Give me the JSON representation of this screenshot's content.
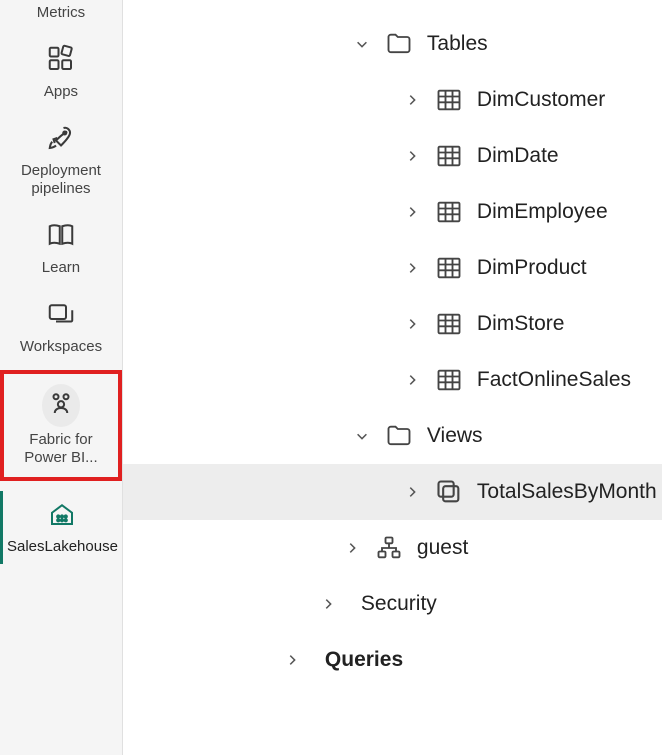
{
  "sidebar": {
    "items": [
      {
        "label": "Metrics"
      },
      {
        "label": "Apps"
      },
      {
        "label": "Deployment pipelines"
      },
      {
        "label": "Learn"
      },
      {
        "label": "Workspaces"
      },
      {
        "label": "Fabric for Power BI..."
      },
      {
        "label": "SalesLakehouse"
      }
    ]
  },
  "tree": {
    "tables": {
      "label": "Tables",
      "items": [
        "DimCustomer",
        "DimDate",
        "DimEmployee",
        "DimProduct",
        "DimStore",
        "FactOnlineSales"
      ]
    },
    "views": {
      "label": "Views",
      "items": [
        "TotalSalesByMonth"
      ]
    },
    "guest": {
      "label": "guest"
    },
    "security": {
      "label": "Security"
    },
    "queries": {
      "label": "Queries"
    }
  }
}
